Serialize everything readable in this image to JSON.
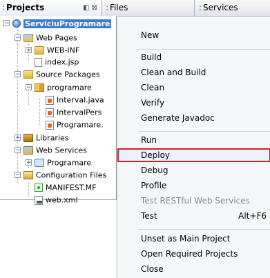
{
  "tabs": {
    "projects": "Projects",
    "files": "Files",
    "services": "Services",
    "projects_icons": "◧ ⊠"
  },
  "tree": {
    "root": "ServiciuProgramare",
    "web_pages": "Web Pages",
    "web_inf": "WEB-INF",
    "index_jsp": "index.jsp",
    "source_packages": "Source Packages",
    "package": "programare",
    "java_files": [
      "Interval.java",
      "IntervalPers",
      "Programare."
    ],
    "libraries": "Libraries",
    "web_services": "Web Services",
    "ws_programare": "Programare",
    "config_files": "Configuration Files",
    "manifest": "MANIFEST.MF",
    "web_xml": "web.xml"
  },
  "menu": {
    "new": "New",
    "build": "Build",
    "clean_build": "Clean and Build",
    "clean": "Clean",
    "verify": "Verify",
    "javadoc": "Generate Javadoc",
    "run": "Run",
    "deploy": "Deploy",
    "debug": "Debug",
    "profile": "Profile",
    "test_restful": "Test RESTful Web Services",
    "test": "Test",
    "test_shortcut": "Alt+F6",
    "unset_main": "Unset as Main Project",
    "open_required": "Open Required Projects",
    "close": "Close"
  },
  "colors": {
    "selection": "#3d7bd6",
    "highlight_border": "#d21e2a"
  }
}
